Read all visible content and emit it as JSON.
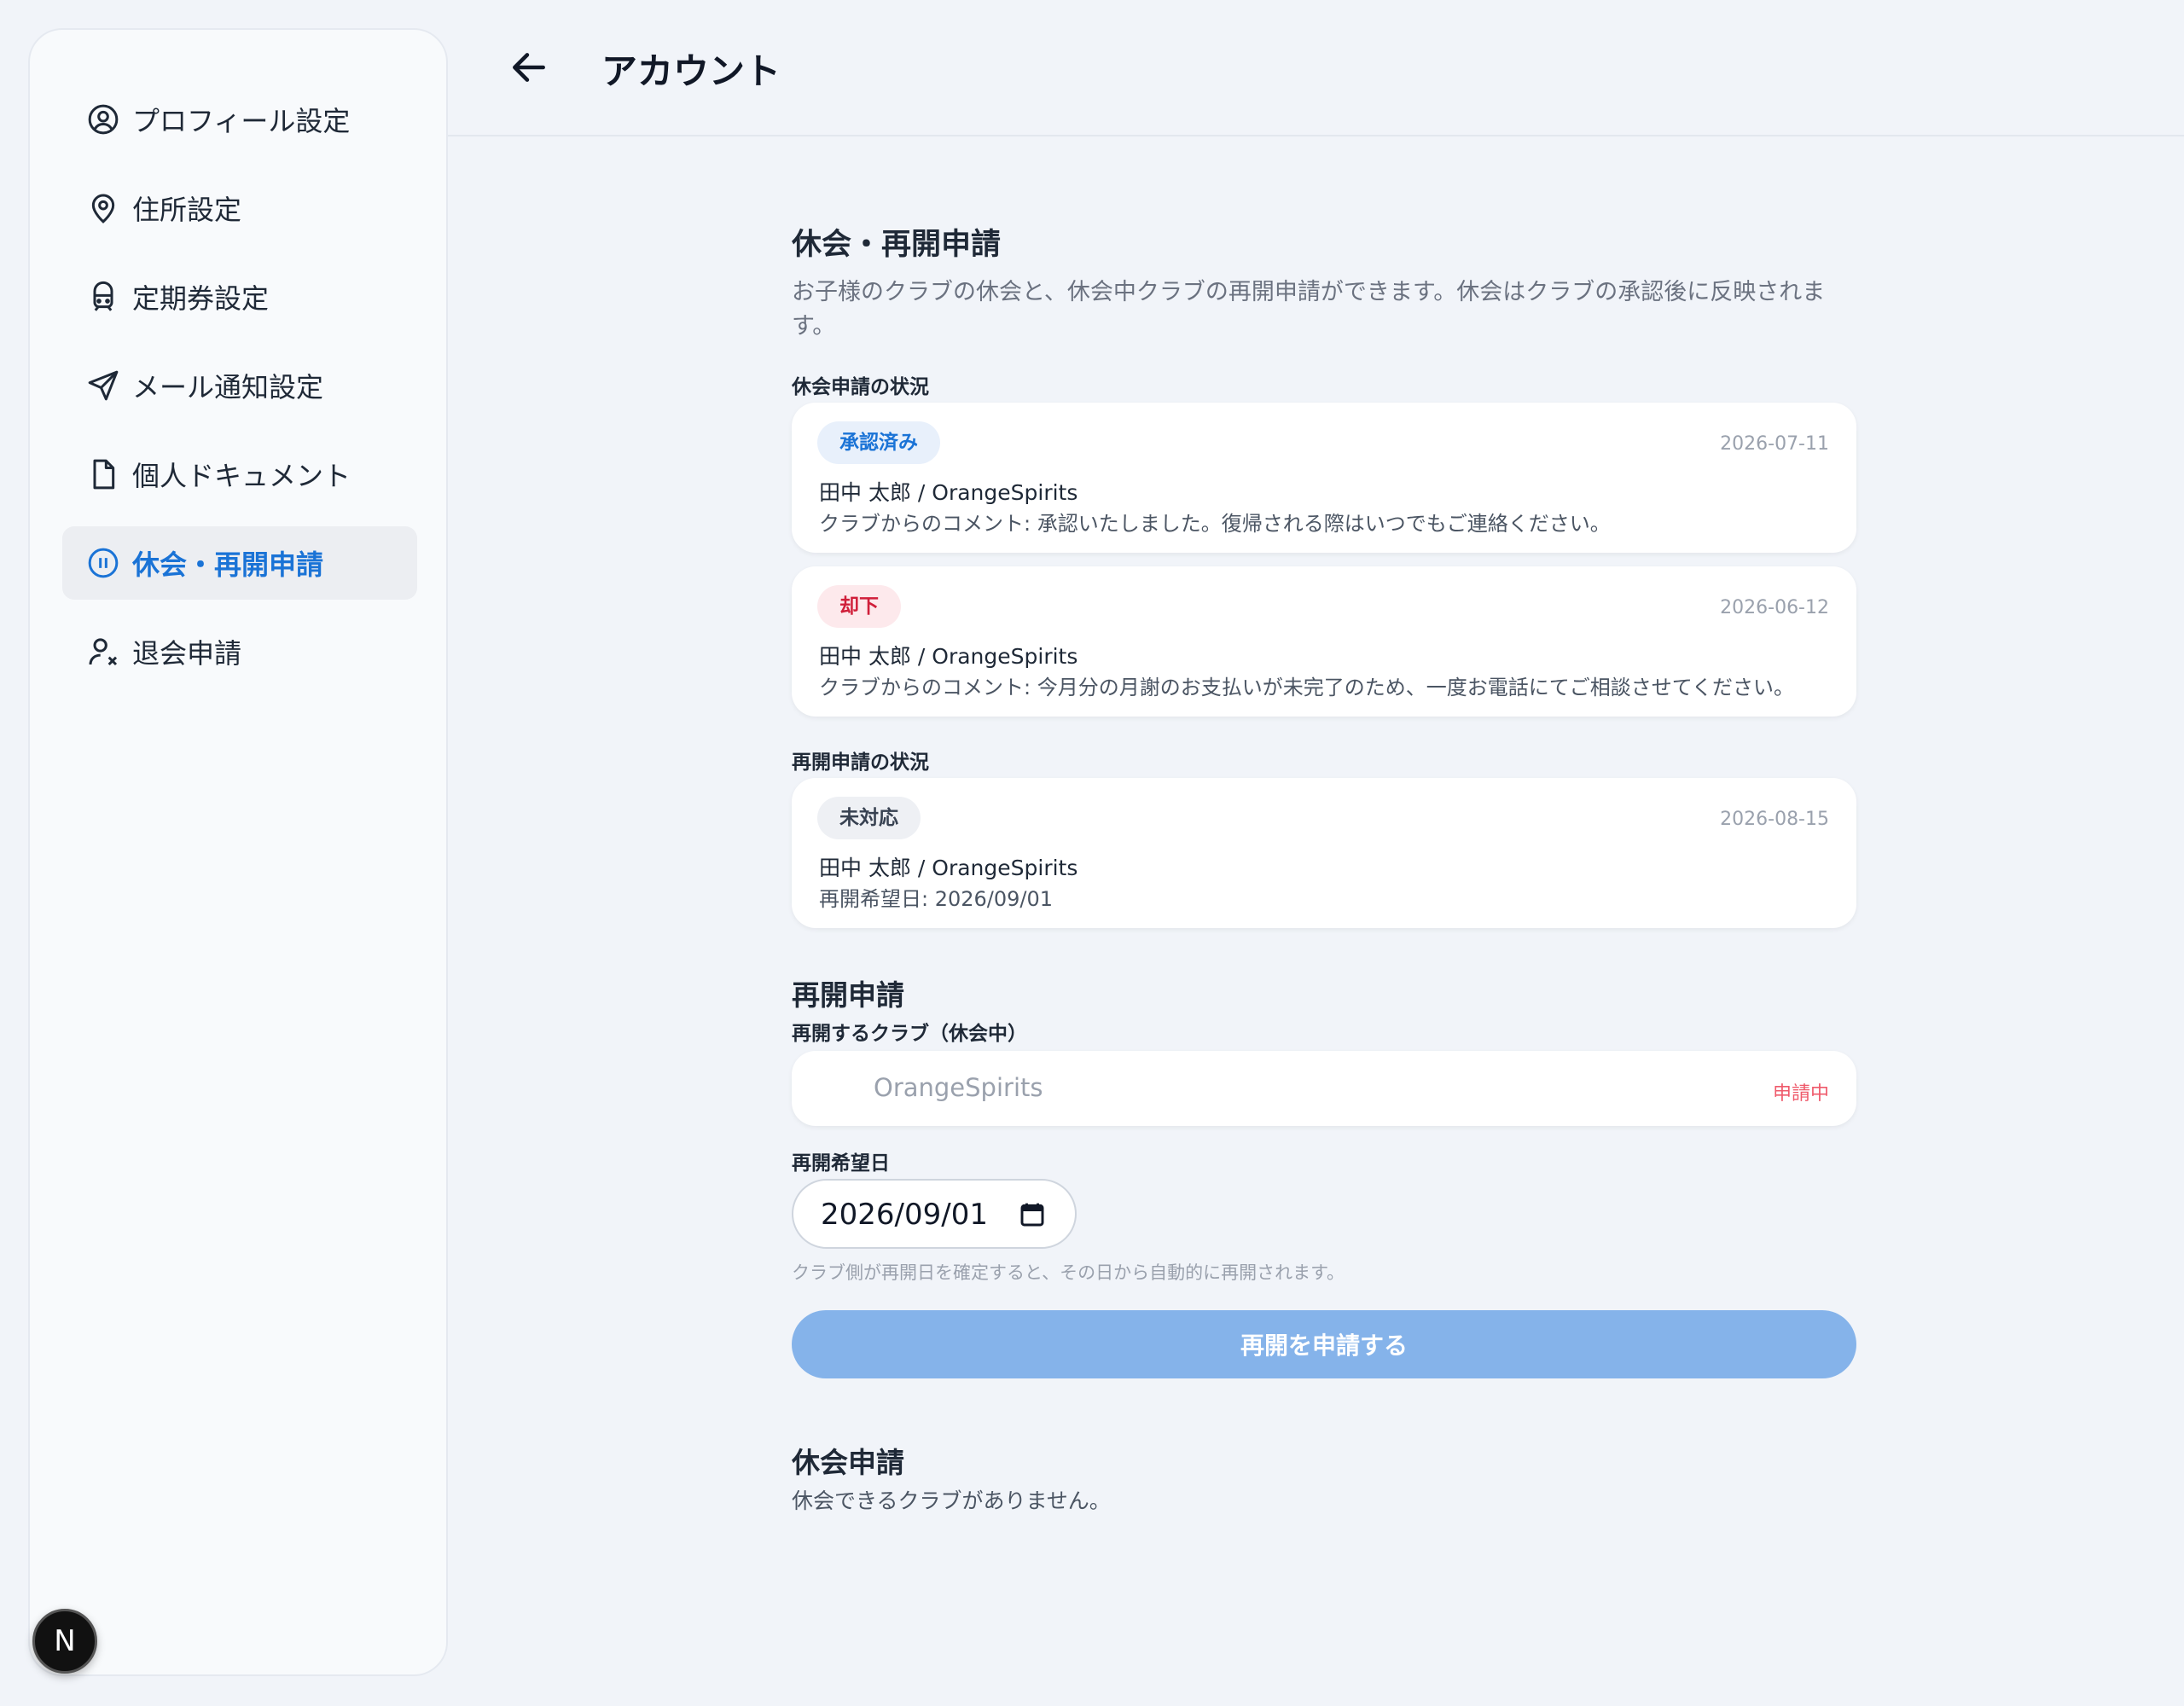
{
  "sidebar": {
    "items": [
      {
        "label": "プロフィール設定",
        "icon": "user-circle-icon",
        "active": false
      },
      {
        "label": "住所設定",
        "icon": "map-pin-icon",
        "active": false
      },
      {
        "label": "定期券設定",
        "icon": "train-icon",
        "active": false
      },
      {
        "label": "メール通知設定",
        "icon": "send-icon",
        "active": false
      },
      {
        "label": "個人ドキュメント",
        "icon": "document-icon",
        "active": false
      },
      {
        "label": "休会・再開申請",
        "icon": "pause-circle-icon",
        "active": true
      },
      {
        "label": "退会申請",
        "icon": "user-x-icon",
        "active": false
      }
    ],
    "badge_letter": "N"
  },
  "header": {
    "title": "アカウント",
    "back_icon": "arrow-left-icon"
  },
  "main": {
    "title": "休会・再開申請",
    "description": "お子様のクラブの休会と、休会中クラブの再開申請ができます。休会はクラブの承認後に反映されます。",
    "suspension_status_label": "休会申請の状況",
    "suspension_requests": [
      {
        "status": "承認済み",
        "date": "2026-07-11",
        "name": "田中 太郎 / OrangeSpirits",
        "comment": "クラブからのコメント: 承認いたしました。復帰される際はいつでもご連絡ください。"
      },
      {
        "status": "却下",
        "date": "2026-06-12",
        "name": "田中 太郎 / OrangeSpirits",
        "comment": "クラブからのコメント: 今月分の月謝のお支払いが未完了のため、一度お電話にてご相談させてください。"
      }
    ],
    "resume_status_label": "再開申請の状況",
    "resume_requests": [
      {
        "status": "未対応",
        "date": "2026-08-15",
        "name": "田中 太郎 / OrangeSpirits",
        "comment": "再開希望日: 2026/09/01"
      }
    ],
    "resume_form": {
      "title": "再開申請",
      "club_label": "再開するクラブ（休会中）",
      "club_value": "OrangeSpirits",
      "club_status": "申請中",
      "date_label": "再開希望日",
      "date_value": "2026/09/01",
      "hint": "クラブ側が再開日を確定すると、その日から自動的に再開されます。",
      "submit_label": "再開を申請する"
    },
    "suspend_form": {
      "title": "休会申請",
      "empty_text": "休会できるクラブがありません。"
    }
  },
  "colors": {
    "accent": "#1a73d6",
    "button_disabled": "#85b3ea",
    "rejected": "#d01f3a",
    "background": "#f1f4f9"
  }
}
